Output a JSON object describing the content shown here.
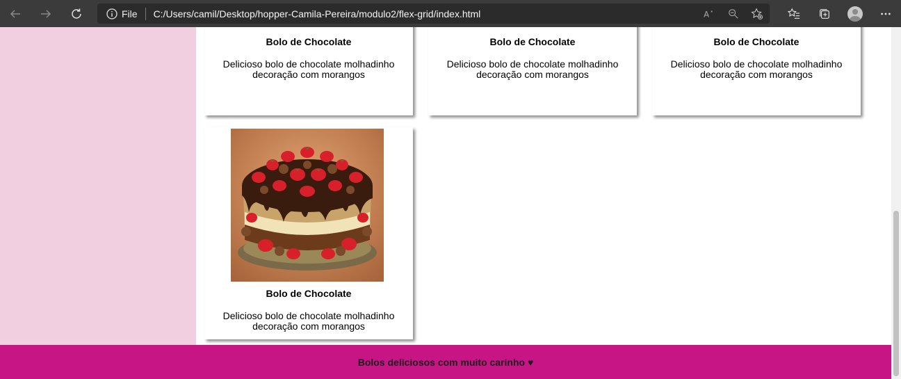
{
  "browser": {
    "file_label": "File",
    "url": "C:/Users/camil/Desktop/hopper-Camila-Pereira/modulo2/flex-grid/index.html",
    "icons": [
      "back-icon",
      "forward-icon",
      "refresh-icon",
      "info-icon",
      "read-aloud-icon",
      "zoom-out-icon",
      "add-favorite-icon",
      "favorites-icon",
      "collections-icon",
      "profile-icon",
      "more-icon"
    ]
  },
  "cards": [
    {
      "title": "Bolo de Chocolate",
      "desc_line1": "Delicioso bolo de chocolate molhadinho",
      "desc_line2": "decoração com morangos"
    },
    {
      "title": "Bolo de Chocolate",
      "desc_line1": "Delicioso bolo de chocolate molhadinho",
      "desc_line2": "decoração com morangos"
    },
    {
      "title": "Bolo de Chocolate",
      "desc_line1": "Delicioso bolo de chocolate molhadinho",
      "desc_line2": "decoração com morangos"
    },
    {
      "title": "Bolo de Chocolate",
      "desc_line1": "Delicioso bolo de chocolate molhadinho",
      "desc_line2": "decoração com morangos"
    }
  ],
  "footer": {
    "text": "Bolos deliciosos com muito carinho ♥"
  },
  "colors": {
    "sidebar": "#f1cfe1",
    "footer": "#c71585",
    "toolbar": "#3b3b3b"
  }
}
